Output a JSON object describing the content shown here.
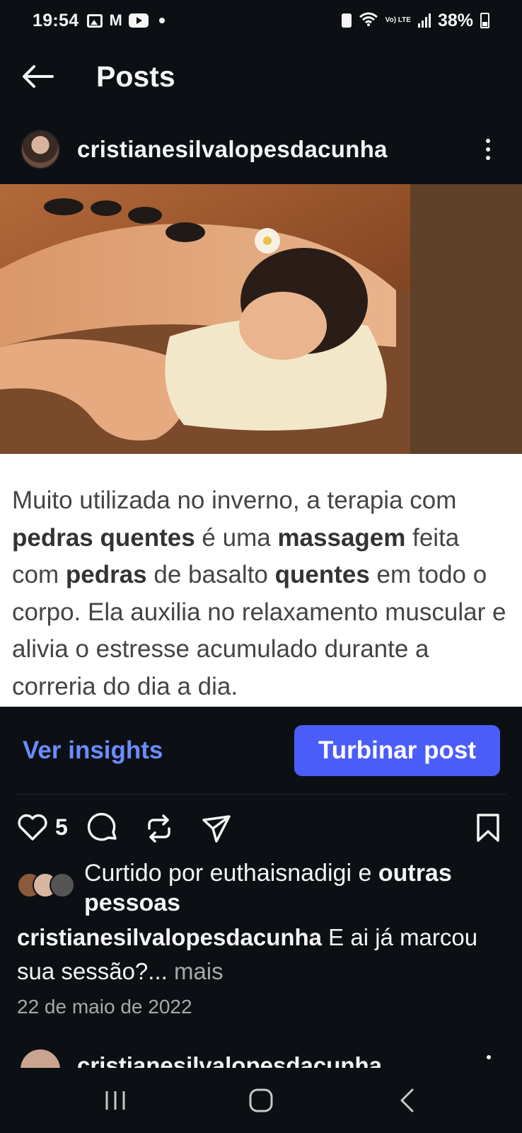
{
  "status_bar": {
    "time": "19:54",
    "battery_percent": "38%",
    "left_icons": [
      "gallery-icon",
      "gmail-icon",
      "youtube-icon",
      "notification-dot-icon"
    ],
    "right_icons": [
      "battery-saver-icon",
      "wifi-icon",
      "volte-icon",
      "signal-icon",
      "battery-icon"
    ],
    "volte_label": "Vo) LTE"
  },
  "header": {
    "title": "Posts",
    "back_icon": "arrow-left-icon"
  },
  "post": {
    "author": "cristianesilvalopesdacunha",
    "image_alt": "hot stone massage",
    "caption_card": {
      "segments": [
        {
          "text": "Muito utilizada no inverno, a terapia com ",
          "bold": false
        },
        {
          "text": "pedras quentes",
          "bold": true
        },
        {
          "text": " é uma ",
          "bold": false
        },
        {
          "text": "massagem",
          "bold": true
        },
        {
          "text": " feita com ",
          "bold": false
        },
        {
          "text": "pedras",
          "bold": true
        },
        {
          "text": " de basalto ",
          "bold": false
        },
        {
          "text": "quentes",
          "bold": true
        },
        {
          "text": " em todo o corpo. Ela auxilia no relaxamento muscular e alivia o estresse acumulado durante a correria do dia a dia.",
          "bold": false
        }
      ]
    },
    "insights_label": "Ver insights",
    "boost_label": "Turbinar post",
    "like_count": "5",
    "liked_by": {
      "prefix": "Curtido por ",
      "user": "euthaisnadigi",
      "connector": " e ",
      "others": "outras pessoas"
    },
    "caption": {
      "author": "cristianesilvalopesdacunha",
      "text": " E ai já marcou sua sessão?...",
      "more": " mais"
    },
    "date": "22 de maio de 2022"
  },
  "next_post": {
    "author": "cristianesilvalopesdacunha"
  },
  "colors": {
    "background": "#0c1014",
    "accent_button": "#4a5df9",
    "link": "#6b8cff",
    "secondary_text": "#a8a8a8"
  }
}
